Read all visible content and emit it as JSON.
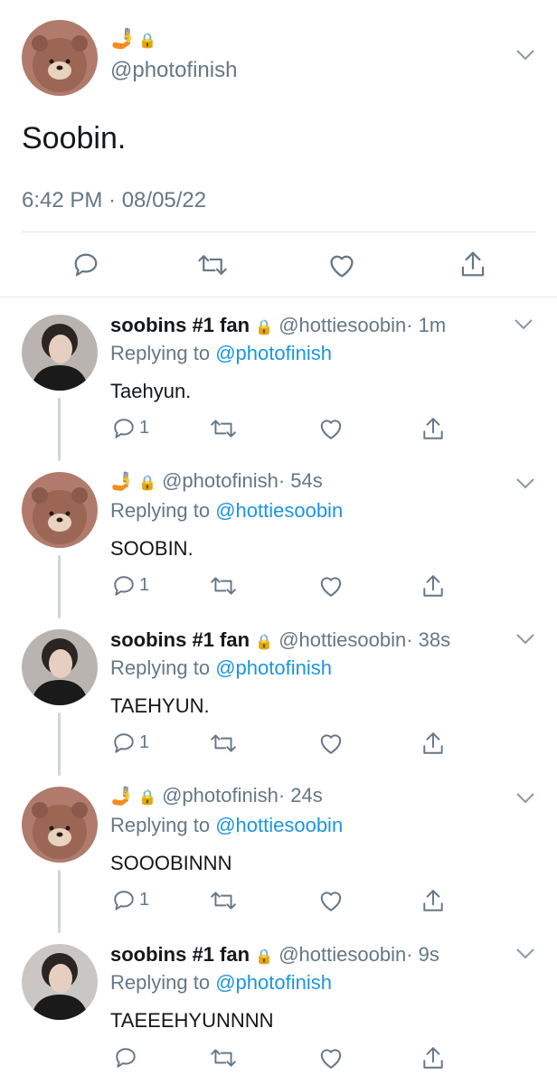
{
  "main_tweet": {
    "handle": "@photofinish",
    "name_emoji": "🤳🔒",
    "text": "Soobin.",
    "timestamp": "6:42 PM · 08/05/22"
  },
  "replies": [
    {
      "name": "soobins #1 fan",
      "handle": "@hottiesoobin",
      "time": "· 1m",
      "replying_prefix": "Replying to",
      "replying_to": "@photofinish",
      "text": "Taehyun.",
      "reply_count": "1"
    },
    {
      "name": "",
      "handle": "@photofinish",
      "time": "· 54s",
      "replying_prefix": "Replying to",
      "replying_to": "@hottiesoobin",
      "text": "SOOBIN.",
      "reply_count": "1"
    },
    {
      "name": "soobins #1 fan",
      "handle": "@hottiesoobin",
      "time": "· 38s",
      "replying_prefix": "Replying to",
      "replying_to": "@photofinish",
      "text": "TAEHYUN.",
      "reply_count": "1"
    },
    {
      "name": "",
      "handle": "@photofinish",
      "time": "· 24s",
      "replying_prefix": "Replying to",
      "replying_to": "@hottiesoobin",
      "text": "SOOOBINNN",
      "reply_count": "1"
    },
    {
      "name": "soobins #1 fan",
      "handle": "@hottiesoobin",
      "time": "· 9s",
      "replying_prefix": "Replying to",
      "replying_to": "@photofinish",
      "text": "TAEEEHYUNNNN",
      "reply_count": ""
    }
  ],
  "colors": {
    "link": "#1b95e0",
    "muted": "#657786",
    "text": "#14171a",
    "thread_line": "#ccd6dd"
  },
  "icons": [
    "reply-icon",
    "retweet-icon",
    "like-icon",
    "share-icon",
    "chevron-down-icon",
    "lock-icon",
    "selfie-emoji-icon"
  ]
}
